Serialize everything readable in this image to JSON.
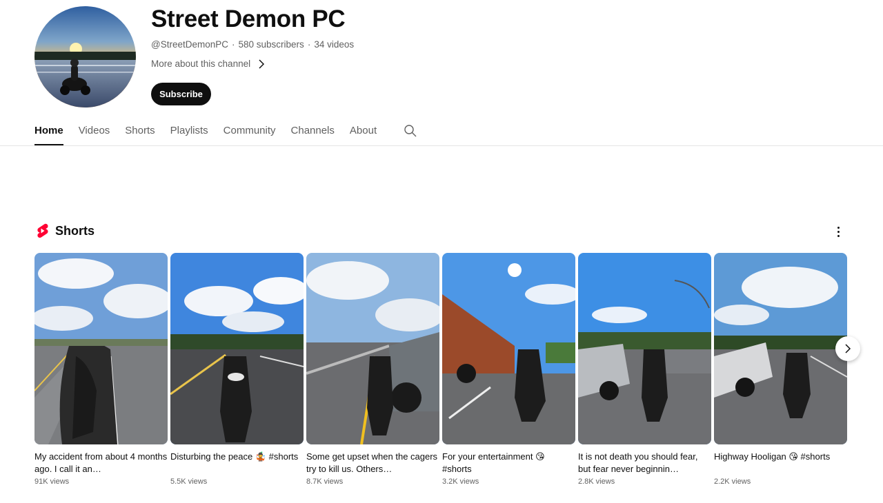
{
  "channel": {
    "name": "Street Demon PC",
    "handle": "@StreetDemonPC",
    "subscribers": "580 subscribers",
    "videos": "34 videos",
    "more_about": "More about this channel",
    "subscribe_label": "Subscribe"
  },
  "tabs": [
    {
      "label": "Home",
      "active": true
    },
    {
      "label": "Videos"
    },
    {
      "label": "Shorts"
    },
    {
      "label": "Playlists"
    },
    {
      "label": "Community"
    },
    {
      "label": "Channels"
    },
    {
      "label": "About"
    }
  ],
  "shorts_section": {
    "title": "Shorts",
    "icon": "youtube-shorts-icon",
    "items": [
      {
        "title": "My accident from about 4 months ago. I call it an…",
        "views": "91K views"
      },
      {
        "title": "Disturbing the peace 🤹 #shorts",
        "views": "5.5K views"
      },
      {
        "title": "Some get upset when the cagers try to kill us. Others…",
        "views": "8.7K views"
      },
      {
        "title": "For your entertainment 😘 #shorts",
        "views": "3.2K views"
      },
      {
        "title": "It is not death you should fear, but fear never beginnin…",
        "views": "2.8K views"
      },
      {
        "title": "Highway Hooligan 😘 #shorts",
        "views": "2.2K views"
      }
    ]
  },
  "colors": {
    "accent": "#0f0f0f",
    "secondary_text": "#606060",
    "shorts_red": "#ff0033"
  }
}
